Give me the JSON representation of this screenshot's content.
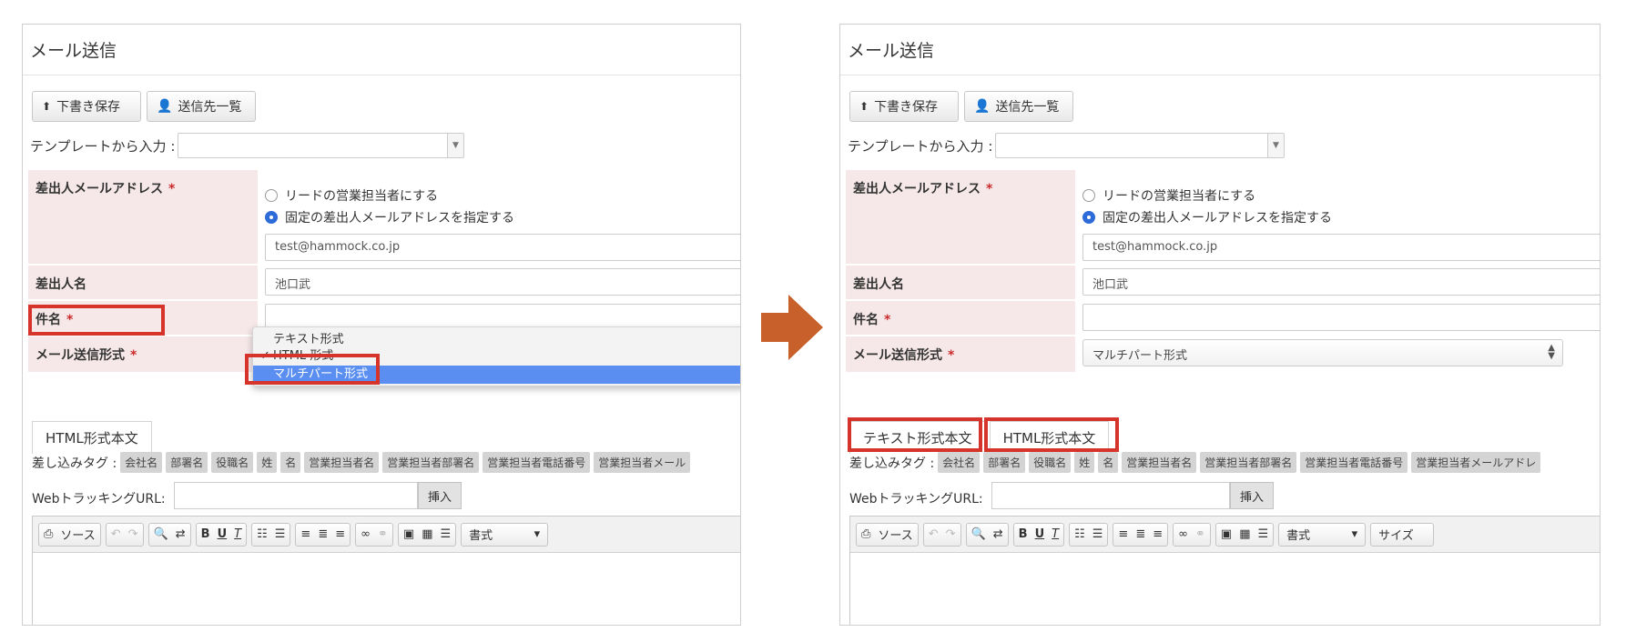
{
  "panels": [
    {
      "title": "メール送信",
      "toolbar": {
        "save_label": "下書き保存",
        "recipients_label": "送信先一覧"
      },
      "template": {
        "label": "テンプレートから入力 :"
      },
      "form": {
        "sender_address": {
          "label": "差出人メールアドレス",
          "required": "*",
          "options": [
            "リードの営業担当者にする",
            "固定の差出人メールアドレスを指定する"
          ],
          "value": "test@hammock.co.jp"
        },
        "sender_name": {
          "label": "差出人名",
          "value": "池口武"
        },
        "subject": {
          "label": "件名",
          "required": "*"
        },
        "mail_format": {
          "label": "メール送信形式",
          "required": "*"
        }
      },
      "dropdown": {
        "options": [
          "テキスト形式",
          "HTML 形式",
          "マルチパート形式"
        ],
        "checked": "✓"
      },
      "tabs": [
        "HTML形式本文"
      ],
      "merge_tags": {
        "label": "差し込みタグ :",
        "tags": [
          "会社名",
          "部署名",
          "役職名",
          "姓",
          "名",
          "営業担当者名",
          "営業担当者部署名",
          "営業担当者電話番号",
          "営業担当者メール"
        ]
      },
      "tracking": {
        "label": "WebトラッキングURL:",
        "insert_label": "挿入"
      },
      "editor": {
        "source_label": "ソース",
        "format_label": "書式"
      }
    },
    {
      "title": "メール送信",
      "toolbar": {
        "save_label": "下書き保存",
        "recipients_label": "送信先一覧"
      },
      "template": {
        "label": "テンプレートから入力 :"
      },
      "form": {
        "sender_address": {
          "label": "差出人メールアドレス",
          "required": "*",
          "options": [
            "リードの営業担当者にする",
            "固定の差出人メールアドレスを指定する"
          ],
          "value": "test@hammock.co.jp"
        },
        "sender_name": {
          "label": "差出人名",
          "value": "池口武"
        },
        "subject": {
          "label": "件名",
          "required": "*"
        },
        "mail_format": {
          "label": "メール送信形式",
          "required": "*",
          "value": "マルチパート形式"
        }
      },
      "tabs": [
        "テキスト形式本文",
        "HTML形式本文"
      ],
      "merge_tags": {
        "label": "差し込みタグ :",
        "tags": [
          "会社名",
          "部署名",
          "役職名",
          "姓",
          "名",
          "営業担当者名",
          "営業担当者部署名",
          "営業担当者電話番号",
          "営業担当者メールアドレ"
        ]
      },
      "tracking": {
        "label": "WebトラッキングURL:",
        "insert_label": "挿入"
      },
      "editor": {
        "source_label": "ソース",
        "format_label": "書式",
        "size_label": "サイズ"
      }
    }
  ],
  "colors": {
    "highlight": "#d6332a",
    "arrow": "#c8602c",
    "required": "#cc2b2b",
    "label_bg": "#f6e8e9",
    "selected_option": "#5a8ef0"
  },
  "icons": [
    "upload-icon",
    "user-icon",
    "dropdown-arrow-icon",
    "source-icon",
    "undo-icon",
    "redo-icon",
    "search-icon",
    "replace-icon",
    "bold-icon",
    "underline-icon",
    "clear-format-icon",
    "numbered-list-icon",
    "bullet-list-icon",
    "align-left-icon",
    "align-center-icon",
    "align-right-icon",
    "link-icon",
    "unlink-icon",
    "image-icon",
    "table-icon",
    "horizontal-rule-icon",
    "arrow-right-icon"
  ]
}
